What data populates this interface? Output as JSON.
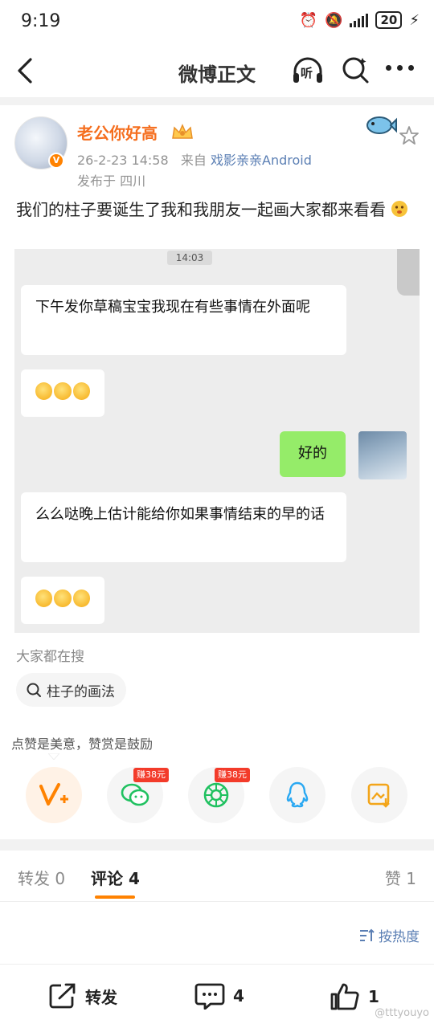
{
  "status_bar": {
    "time": "9:19",
    "battery": "20"
  },
  "nav": {
    "title": "微博正文",
    "listen_label": "听"
  },
  "post": {
    "username": "老公你好高",
    "timestamp": "26-2-23 14:58",
    "source_prefix": "来自",
    "source": "戏影亲亲Android",
    "location": "发布于 四川",
    "text": "我们的柱子要诞生了我和我朋友一起画大家都来看看"
  },
  "chat": {
    "time": "14:03",
    "messages": [
      {
        "side": "left",
        "text": "下午发你草稿宝宝我现在有些事情在外面呢"
      },
      {
        "side": "left",
        "text": ""
      },
      {
        "side": "right",
        "text": "好的"
      },
      {
        "side": "left",
        "text": "么么哒晚上估计能给你如果事情结束的早的话"
      },
      {
        "side": "left",
        "text": ""
      }
    ]
  },
  "search": {
    "section_label": "大家都在搜",
    "chip": "柱子的画法"
  },
  "like_hint": "点赞是美意，赞赏是鼓励",
  "share": {
    "reward_badge_1": "赚38元",
    "reward_badge_2": "赚38元"
  },
  "tabs": {
    "repost": "转发 0",
    "comment": "评论 4",
    "like": "赞 1"
  },
  "sort_label": "按热度",
  "bottom_bar": {
    "repost_label": "转发",
    "comment_count": "4",
    "like_count": "1"
  },
  "watermark": "@tttyouyo",
  "colors": {
    "accent": "#ff8200",
    "link": "#5b7fb4",
    "username": "#f56e1e",
    "chat_green": "#95ec69"
  }
}
